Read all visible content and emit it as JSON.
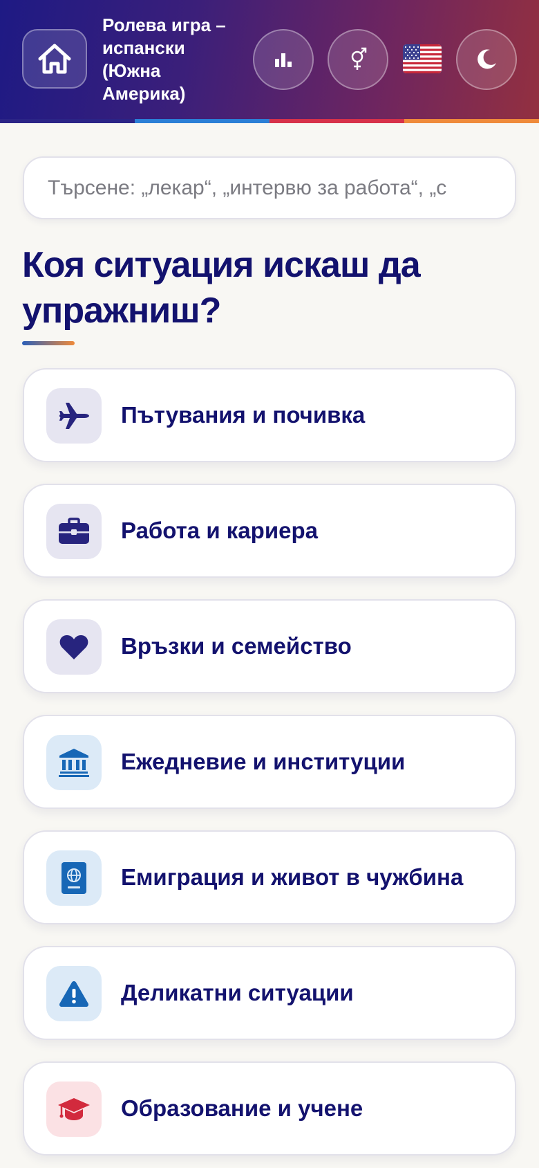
{
  "header": {
    "title": "Ролева игра – испански (Южна Америка)",
    "icons": {
      "home": "home-icon",
      "stats": "bar-chart-icon",
      "gender": "gender-icon",
      "flag": "us-flag-icon",
      "theme": "moon-icon"
    },
    "colors": {
      "gradient_start": "#1e1a84",
      "gradient_end": "#933040",
      "stripe": [
        "#2b2486",
        "#2b7fd6",
        "#d7314a",
        "#ef8a3a"
      ]
    }
  },
  "search": {
    "placeholder": "Търсене: „лекар“, „интервю за работа“, „с"
  },
  "heading": {
    "text": "Коя ситуация искаш да упражниш?"
  },
  "categories": [
    {
      "label": "Пътувания и почивка",
      "icon": "airplane-icon",
      "tint": "purple"
    },
    {
      "label": "Работа и кариера",
      "icon": "briefcase-icon",
      "tint": "purple"
    },
    {
      "label": "Връзки и семейство",
      "icon": "heart-icon",
      "tint": "purple"
    },
    {
      "label": "Ежедневие и институции",
      "icon": "institution-icon",
      "tint": "blue"
    },
    {
      "label": "Емиграция и живот в чужбина",
      "icon": "passport-icon",
      "tint": "blue"
    },
    {
      "label": "Деликатни ситуации",
      "icon": "warning-icon",
      "tint": "blue"
    },
    {
      "label": "Образование и учене",
      "icon": "graduation-cap-icon",
      "tint": "pink"
    }
  ]
}
